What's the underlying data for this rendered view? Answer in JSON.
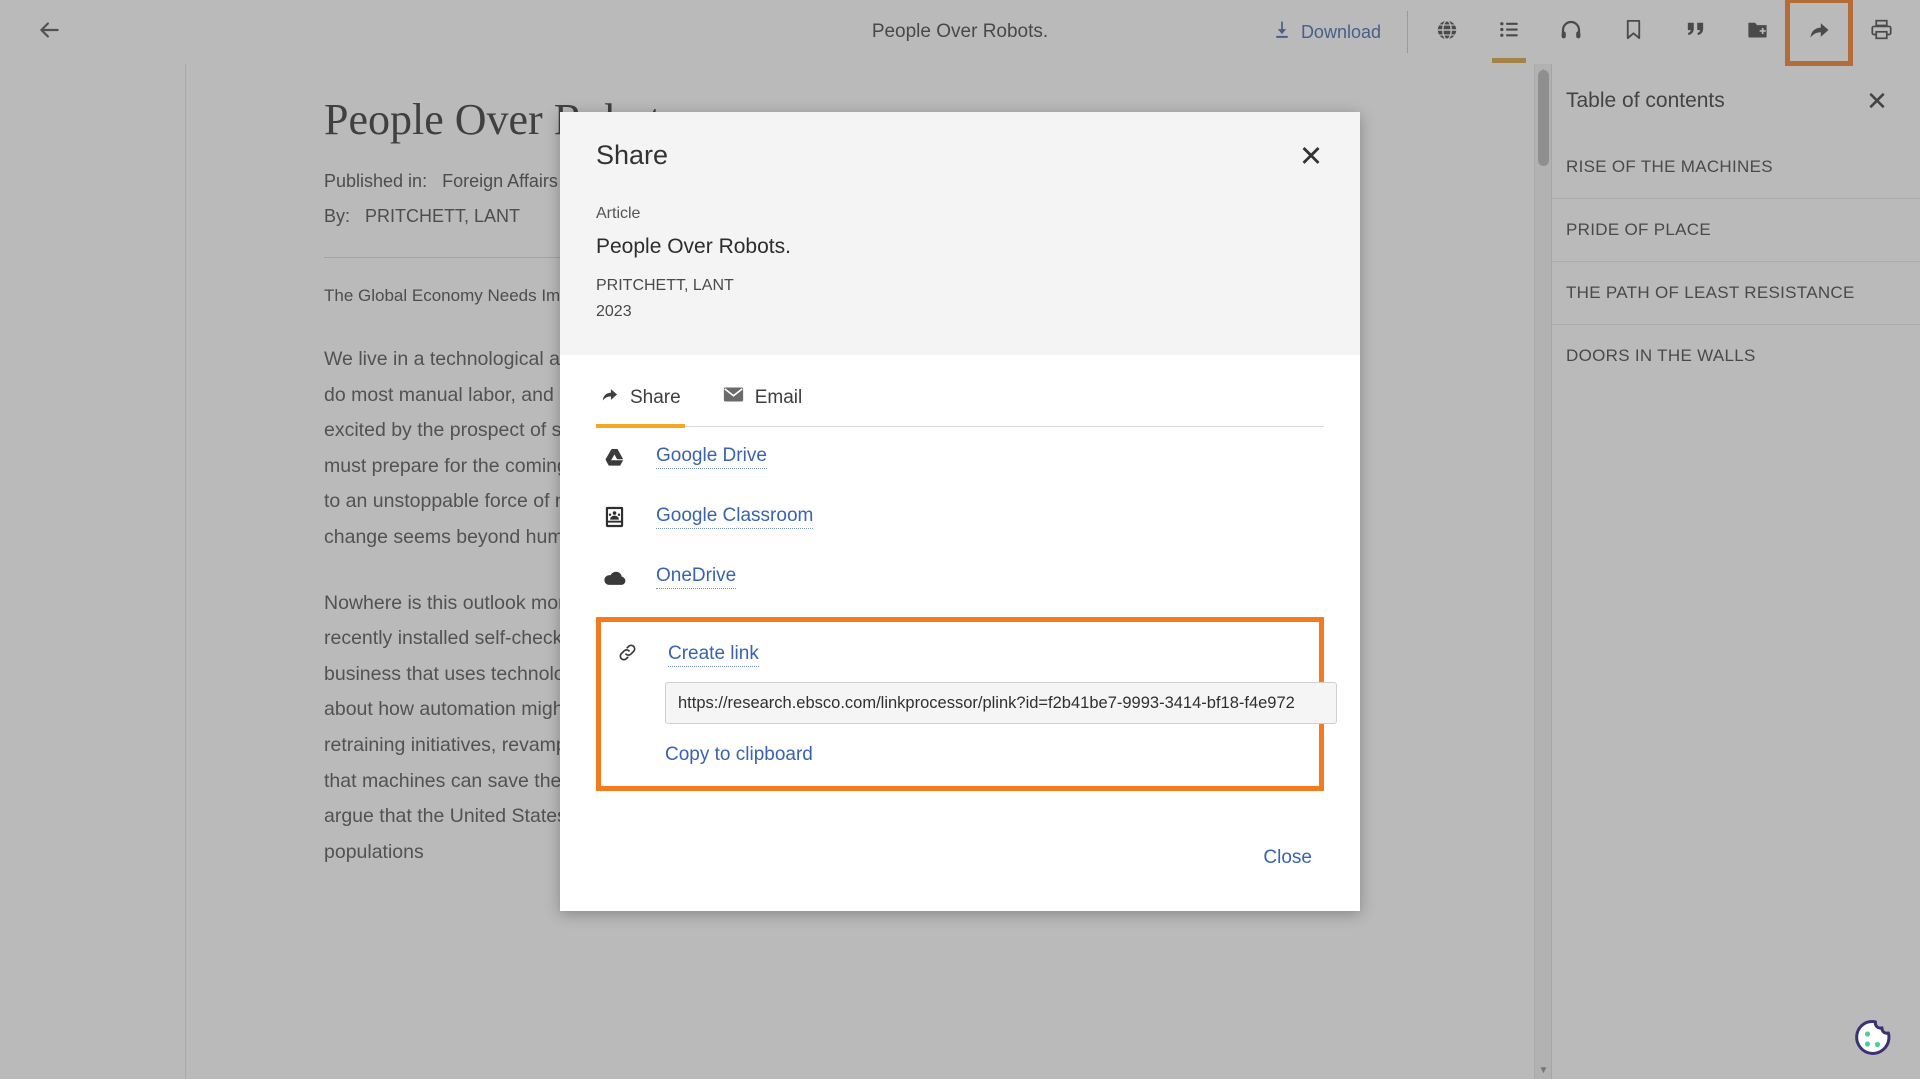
{
  "toolbar": {
    "back_icon": "arrow-left-icon",
    "doc_title": "People Over Robots.",
    "download_label": "Download",
    "download_icon": "download-icon",
    "icons": [
      {
        "name": "translate-globe-icon",
        "glyph": "globe"
      },
      {
        "name": "table-of-contents-icon",
        "glyph": "list"
      },
      {
        "name": "listen-audio-icon",
        "glyph": "headphones"
      },
      {
        "name": "bookmark-icon",
        "glyph": "bookmark"
      },
      {
        "name": "cite-quote-icon",
        "glyph": "quote"
      },
      {
        "name": "add-to-project-folder-icon",
        "glyph": "folder-plus"
      },
      {
        "name": "share-icon",
        "glyph": "share-arrow"
      },
      {
        "name": "print-icon",
        "glyph": "printer"
      }
    ]
  },
  "document": {
    "title": "People Over Robots.",
    "published_label": "Published in:",
    "published_value": "Foreign Affairs",
    "by_label": "By:",
    "by_value": "PRITCHETT, LANT",
    "subtitle": "The Global Economy Needs Immigrants More Than Robots",
    "paragraphs": [
      "We live in a technological age, and new machines are poised to reshape every corner of human life: robots will soon do most manual labor, and systems driven by artificial intelligence will govern whole industries. Many people are excited by the prospect of such advances, worrying only about how quickly they will arrive. Governments, they argue, must prepare for the coming revolution. Such narratives almost always treat technological change as something akin to an unstoppable force of nature, barreling inexorably toward societies that can only brace for impact. The pace of change seems beyond human control; the best that governments can do is figure out how best to adapt.",
      "Nowhere is this outlook more prevalent than in discussions of automation's effect on jobs. My local grocery store recently installed self-checkout machines, proclaiming the company's commitment to \"innovation.\" It is hardly the only business that uses technology to replace work that was once done by human employees. Much ink has been spilled about how automation might change the labor market and what governments should do in response: invest in job retraining initiatives, revamp education systems, or strengthen social safety nets. Indeed, many governments hope that machines can save their economies from the consequences of demographic decline and aging. Techno-optimists argue that the United States and many other wealthy countries need automation to make up for dwindling working-age populations"
    ]
  },
  "toc": {
    "title": "Table of contents",
    "close_icon": "close-icon",
    "items": [
      {
        "label": "RISE OF THE MACHINES"
      },
      {
        "label": "PRIDE OF PLACE"
      },
      {
        "label": "THE PATH OF LEAST RESISTANCE"
      },
      {
        "label": "DOORS IN THE WALLS"
      }
    ]
  },
  "share_modal": {
    "title": "Share",
    "close_icon": "close-icon",
    "resource": {
      "kind": "Article",
      "title": "People Over Robots.",
      "author": "PRITCHETT, LANT",
      "year": "2023"
    },
    "tabs": [
      {
        "label": "Share",
        "icon": "share-arrow-icon",
        "active": true
      },
      {
        "label": "Email",
        "icon": "envelope-icon",
        "active": false
      }
    ],
    "targets": [
      {
        "label": "Google Drive",
        "icon": "google-drive-icon"
      },
      {
        "label": "Google Classroom",
        "icon": "google-classroom-icon"
      },
      {
        "label": "OneDrive",
        "icon": "onedrive-cloud-icon"
      }
    ],
    "create_link": {
      "label": "Create link",
      "icon": "chain-link-icon",
      "url": "https://research.ebsco.com/linkprocessor/plink?id=f2b41be7-9993-3414-bf18-f4e972",
      "copy_label": "Copy to clipboard"
    },
    "close_label": "Close"
  },
  "cookie_widget": {
    "name": "cookie-consent-icon"
  },
  "colors": {
    "accent_orange": "#f47a20",
    "tab_underline": "#f5a623",
    "link_blue": "#3a63ad",
    "toolbar_active": "#d9a13b"
  }
}
